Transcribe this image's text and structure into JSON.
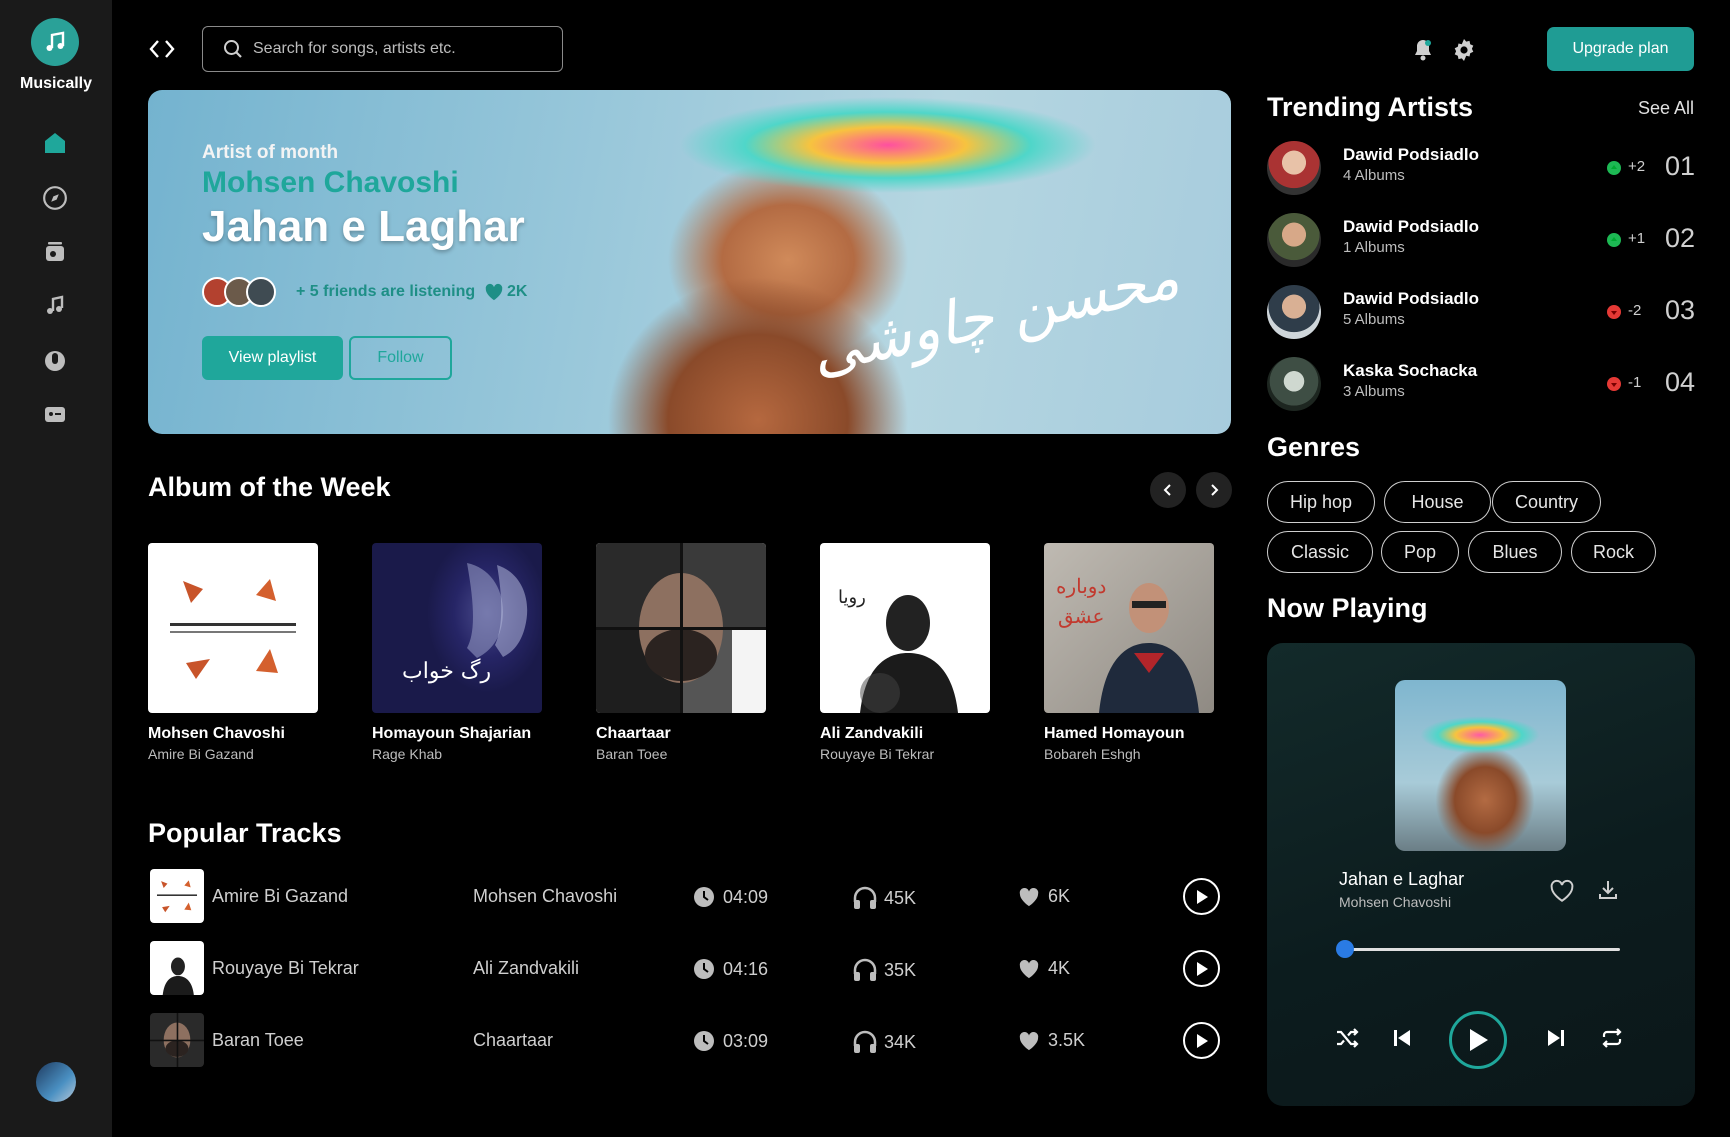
{
  "app": {
    "name": "Musically"
  },
  "search": {
    "placeholder": "Search for songs, artists etc."
  },
  "header": {
    "upgrade_label": "Upgrade plan"
  },
  "hero": {
    "eyebrow": "Artist of month",
    "artist": "Mohsen Chavoshi",
    "title": "Jahan e Laghar",
    "friends_text": "+ 5 friends are listening",
    "likes": "2K",
    "view_playlist_label": "View playlist",
    "follow_label": "Follow",
    "calligraphy": "محسن چاوشی"
  },
  "albums_section": {
    "title": "Album of the Week"
  },
  "albums": [
    {
      "artist": "Mohsen Chavoshi",
      "album": "Amire Bi Gazand"
    },
    {
      "artist": "Homayoun Shajarian",
      "album": "Rage Khab"
    },
    {
      "artist": "Chaartaar",
      "album": "Baran Toee"
    },
    {
      "artist": "Ali Zandvakili",
      "album": "Rouyaye Bi Tekrar"
    },
    {
      "artist": "Hamed Homayoun",
      "album": "Bobareh Eshgh"
    }
  ],
  "tracks_section": {
    "title": "Popular Tracks"
  },
  "tracks": [
    {
      "name": "Amire Bi Gazand",
      "artist": "Mohsen Chavoshi",
      "duration": "04:09",
      "plays": "45K",
      "likes": "6K"
    },
    {
      "name": "Rouyaye Bi Tekrar",
      "artist": "Ali Zandvakili",
      "duration": "04:16",
      "plays": "35K",
      "likes": "4K"
    },
    {
      "name": "Baran Toee",
      "artist": "Chaartaar",
      "duration": "03:09",
      "plays": "34K",
      "likes": "3.5K"
    }
  ],
  "trending": {
    "title": "Trending Artists",
    "see_all": "See All",
    "artists": [
      {
        "name": "Dawid Podsiadlo",
        "albums": "4 Albums",
        "change": "+2",
        "trend": "up",
        "rank": "01"
      },
      {
        "name": "Dawid Podsiadlo",
        "albums": "1 Albums",
        "change": "+1",
        "trend": "up",
        "rank": "02"
      },
      {
        "name": "Dawid Podsiadlo",
        "albums": "5 Albums",
        "change": "-2",
        "trend": "down",
        "rank": "03"
      },
      {
        "name": "Kaska Sochacka",
        "albums": "3 Albums",
        "change": "-1",
        "trend": "down",
        "rank": "04"
      }
    ]
  },
  "genres": {
    "title": "Genres",
    "items": [
      "Hip hop",
      "House",
      "Country",
      "Classic",
      "Pop",
      "Blues",
      "Rock"
    ]
  },
  "now_playing": {
    "title": "Now Playing",
    "track": "Jahan e Laghar",
    "artist": "Mohsen Chavoshi",
    "progress": 0
  },
  "icons": {
    "nav": [
      "home-icon",
      "explore-icon",
      "radio-icon",
      "music-note-icon",
      "microphone-icon",
      "podcast-icon"
    ],
    "header": [
      "notification-icon",
      "settings-icon"
    ]
  },
  "colors": {
    "accent": "#1fa79b",
    "trend_up": "#1db954",
    "trend_down": "#e53935",
    "progress": "#2a7be4",
    "sidebar": "#1a1a1a"
  }
}
